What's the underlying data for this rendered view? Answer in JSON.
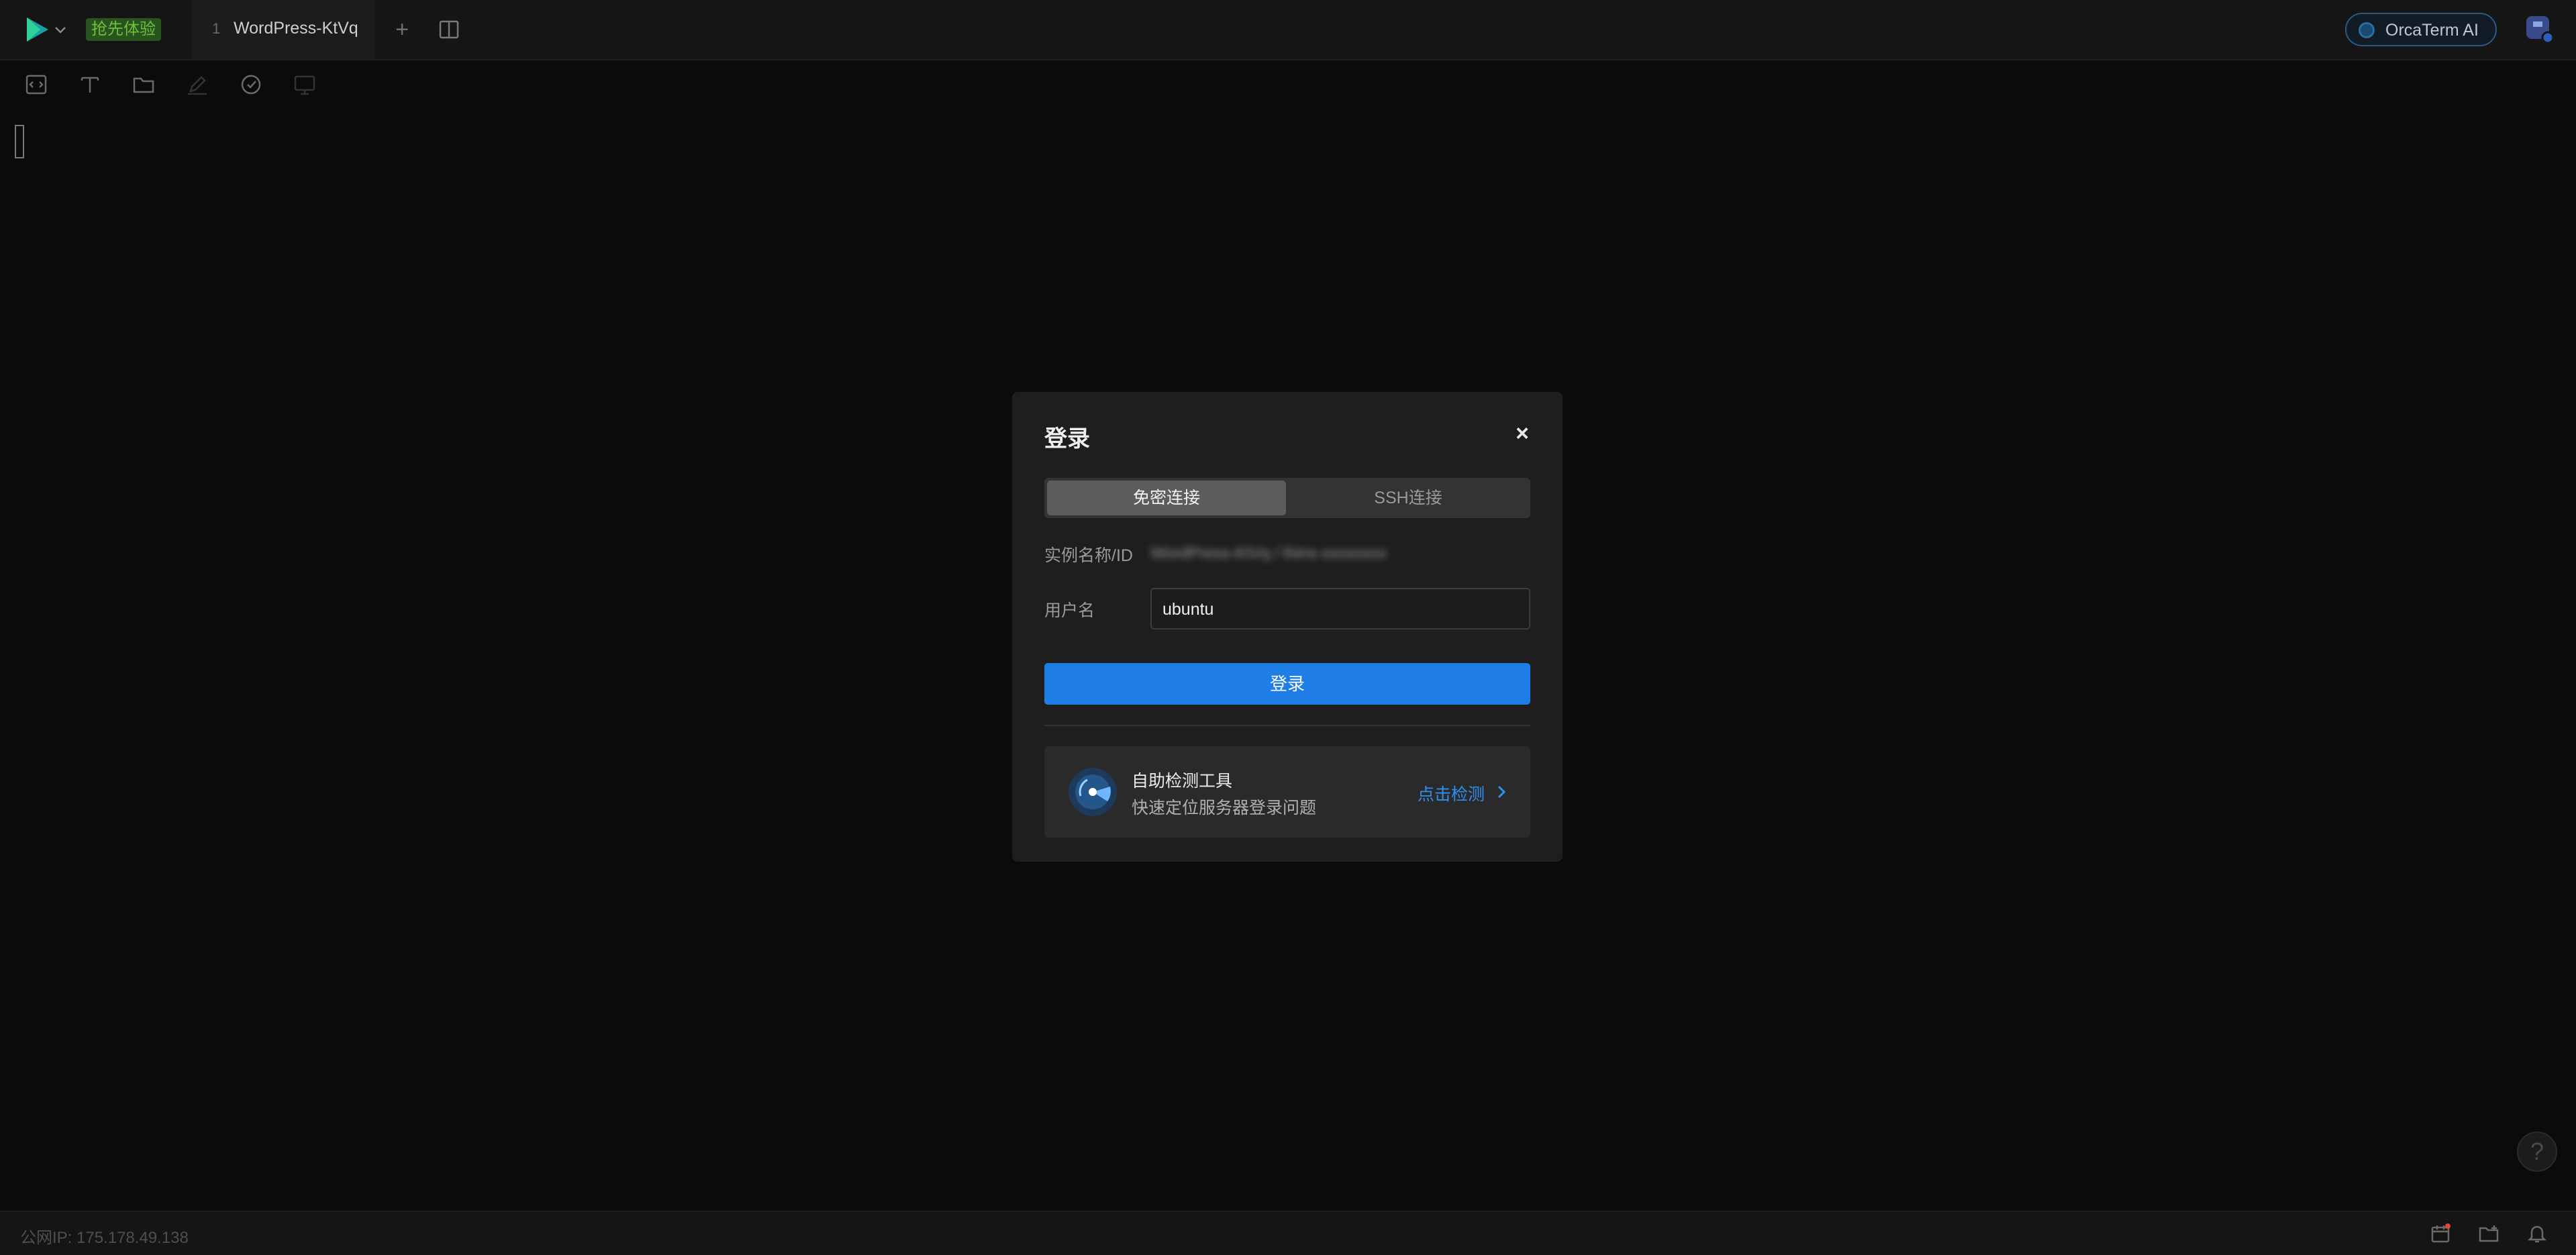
{
  "header": {
    "trial_badge": "抢先体验",
    "tab": {
      "index": "1",
      "title": "WordPress-KtVq"
    },
    "tab_add": "+",
    "ai_button": "OrcaTerm AI"
  },
  "terminal": {},
  "dialog": {
    "title": "登录",
    "close": "×",
    "tabs": [
      {
        "label": "免密连接",
        "active": true
      },
      {
        "label": "SSH连接",
        "active": false
      }
    ],
    "instance_label": "实例名称/ID",
    "instance_value": "WordPress-KtVq / lhins-xxxxxxxx",
    "username_label": "用户名",
    "username_value": "ubuntu",
    "login_button": "登录",
    "tool_card": {
      "title": "自助检测工具",
      "subtitle": "快速定位服务器登录问题",
      "link": "点击检测"
    }
  },
  "statusbar": {
    "public_ip": "公网IP: 175.178.49.138"
  },
  "help": "?",
  "colors": {
    "accent": "#1e7ee5",
    "link": "#2f8ff0",
    "badge_bg": "#29531f",
    "badge_text": "#6fbf3a"
  },
  "icons": [
    "logo-icon",
    "chevron-down-icon",
    "split-view-icon",
    "ai-icon",
    "avatar-icon",
    "code-icon",
    "text-icon",
    "folder-icon",
    "edit-icon",
    "check-circle-icon",
    "monitor-icon",
    "close-icon",
    "radar-icon",
    "chevron-right-icon",
    "calendar-icon",
    "folder-add-icon",
    "bell-icon",
    "help-icon"
  ]
}
